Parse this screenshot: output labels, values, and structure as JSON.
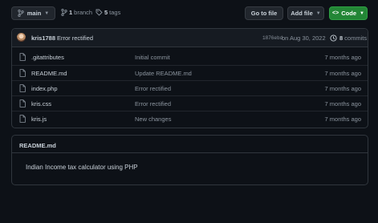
{
  "toolbar": {
    "branch_label": "main",
    "branches_count": "1",
    "branches_label": "branch",
    "tags_count": "5",
    "tags_label": "tags",
    "goto_file_label": "Go to file",
    "add_file_label": "Add file",
    "code_label": "Code"
  },
  "latest_commit": {
    "author": "kris1788",
    "message": "Error rectified",
    "hash": "1876ebd",
    "date": "on Aug 30, 2022",
    "commits_count": "8",
    "commits_label": "commits"
  },
  "files": [
    {
      "name": ".gitattributes",
      "message": "Initial commit",
      "age": "7 months ago"
    },
    {
      "name": "README.md",
      "message": "Update README.md",
      "age": "7 months ago"
    },
    {
      "name": "index.php",
      "message": "Error rectified",
      "age": "7 months ago"
    },
    {
      "name": "kris.css",
      "message": "Error rectified",
      "age": "7 months ago"
    },
    {
      "name": "kris.js",
      "message": "New changes",
      "age": "7 months ago"
    }
  ],
  "readme": {
    "title": "README.md",
    "content": "Indian Income tax calculator using PHP"
  },
  "colors": {
    "background": "#0d1117",
    "accent_green": "#238636",
    "muted_text": "#8b949e"
  },
  "icons": [
    "branch-icon",
    "tag-icon",
    "code-icon",
    "history-icon",
    "file-icon"
  ]
}
